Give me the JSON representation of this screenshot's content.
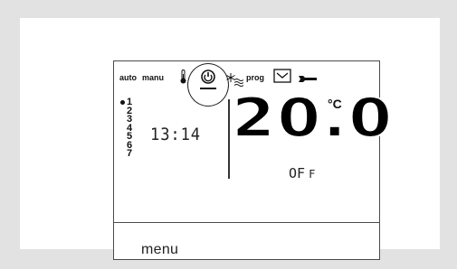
{
  "display": {
    "mode_auto": "auto",
    "mode_manu": "manu",
    "prog_label": "prog",
    "program_numbers": [
      "1",
      "2",
      "3",
      "4",
      "5",
      "6",
      "7"
    ],
    "active_program": "1",
    "clock": "13:14",
    "temperature": "20.0",
    "unit": "°C",
    "status_value": "OF",
    "status_suffix": "F"
  },
  "menu": {
    "label": "menu"
  },
  "icons": [
    "thermometer-icon",
    "standby-power-icon",
    "frost-icon",
    "comfort-waves-icon",
    "envelope-check-icon",
    "wrench-icon"
  ],
  "colors": {
    "background": "#e2e2e2",
    "panel": "#ffffff",
    "ink": "#111111"
  }
}
